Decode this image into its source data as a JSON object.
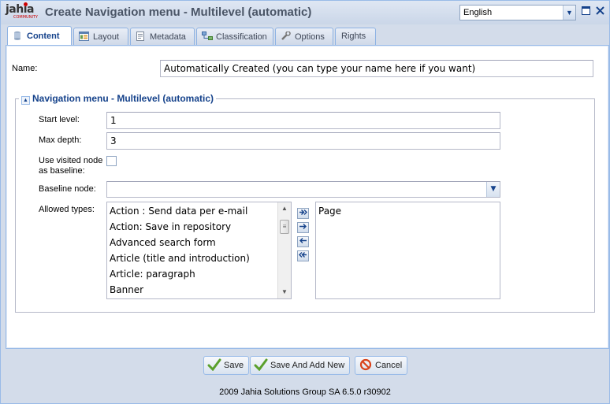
{
  "header": {
    "logo_text": "jahia",
    "logo_sub": "COMMUNITY",
    "title": "Create Navigation menu - Multilevel (automatic)",
    "language": "English",
    "accent": "#15428b"
  },
  "tabs": [
    {
      "label": "Content",
      "icon": "content-icon",
      "active": true
    },
    {
      "label": "Layout",
      "icon": "layout-icon"
    },
    {
      "label": "Metadata",
      "icon": "metadata-icon"
    },
    {
      "label": "Classification",
      "icon": "classification-icon"
    },
    {
      "label": "Options",
      "icon": "options-icon"
    },
    {
      "label": "Rights",
      "icon": ""
    }
  ],
  "form": {
    "name_label": "Name:",
    "name_value": "Automatically Created (you can type your name here if you want)",
    "section_title": "Navigation menu - Multilevel (automatic)",
    "start_level_label": "Start level:",
    "start_level_value": "1",
    "max_depth_label": "Max depth:",
    "max_depth_value": "3",
    "visited_node_label_1": "Use visited node",
    "visited_node_label_2": "as baseline:",
    "visited_node_checked": false,
    "baseline_label": "Baseline node:",
    "baseline_value": "",
    "allowed_types_label": "Allowed types:",
    "available_types": [
      "Action : Send data per e-mail",
      "Action: Save in repository",
      "Advanced search form",
      "Article (title and introduction)",
      "Article: paragraph",
      "Banner"
    ],
    "selected_types": [
      "Page"
    ]
  },
  "footer": {
    "save_label": "Save",
    "save_add_label": "Save And Add New",
    "cancel_label": "Cancel",
    "copyright": "2009 Jahia Solutions Group SA 6.5.0 r30902"
  }
}
